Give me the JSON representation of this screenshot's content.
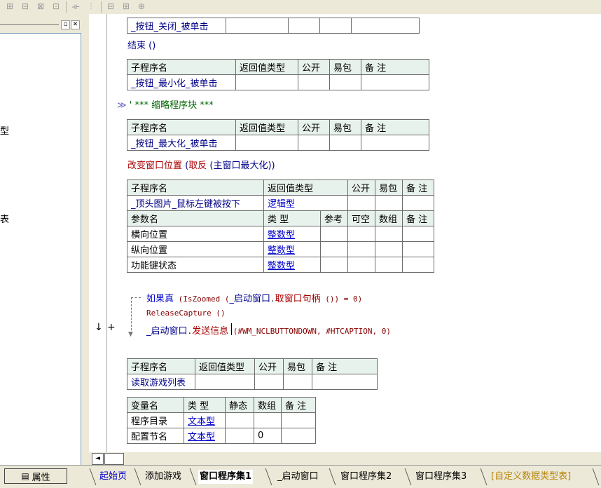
{
  "toolbar": {
    "icons": [
      "align-left-icon",
      "align-center-icon",
      "align-right-icon",
      "align-justify-icon",
      "distribute-h-icon",
      "distribute-v-icon",
      "equal-width-icon",
      "equal-height-icon",
      "equal-size-icon"
    ],
    "glyphs": [
      "⊞",
      "⊟",
      "⊠",
      "⊡",
      "⟛",
      "⫶",
      "⊟",
      "⊞",
      "⊕"
    ]
  },
  "left_panel": {
    "min_glyph": "▫",
    "close_glyph": "✕",
    "glyphs": [
      {
        "text": "型"
      },
      {
        "text": "表"
      }
    ],
    "properties_label": "属性"
  },
  "editor": {
    "table1": {
      "row": [
        "_按钮_关闭_被单击",
        "",
        "",
        "",
        ""
      ]
    },
    "end_text": "结束 ()",
    "table2": {
      "headers": [
        "子程序名",
        "返回值类型",
        "公开",
        "易包",
        "备 注"
      ],
      "row": [
        "_按钮_最小化_被单击",
        "",
        "",
        "",
        ""
      ]
    },
    "collapsed_marker": "≫",
    "collapsed_text": "' *** 缩略程序块 ***",
    "table3": {
      "headers": [
        "子程序名",
        "返回值类型",
        "公开",
        "易包",
        "备 注"
      ],
      "row": [
        "_按钮_最大化_被单击",
        "",
        "",
        "",
        ""
      ]
    },
    "code1": {
      "cmd": "改变窗口位置",
      "open": " (",
      "fn": "取反",
      "open2": " (",
      "arg": "主窗口最大化",
      "close": "))"
    },
    "table4": {
      "headers": [
        "子程序名",
        "返回值类型",
        "公开",
        "易包",
        "备 注"
      ],
      "row": [
        "_顶头图片_鼠标左键被按下",
        "逻辑型",
        "",
        "",
        ""
      ],
      "param_headers": [
        "参数名",
        "类 型",
        "参考",
        "可空",
        "数组",
        "备 注"
      ],
      "params": [
        [
          "横向位置",
          "整数型",
          "",
          "",
          "",
          ""
        ],
        [
          "纵向位置",
          "整数型",
          "",
          "",
          "",
          ""
        ],
        [
          "功能键状态",
          "整数型",
          "",
          "",
          "",
          ""
        ]
      ]
    },
    "code2": {
      "kw": "如果真",
      "a": " (IsZoomed (",
      "b": "_启动窗口",
      "c": ".",
      "d": "取窗口句柄",
      "e": " ()) = 0)"
    },
    "code3": {
      "text": "ReleaseCapture ()"
    },
    "code4": {
      "a": "_启动窗口",
      "b": ".",
      "c": "发送信息",
      "d": " (#WM_NCLBUTTONDOWN, #HTCAPTION, 0)"
    },
    "gutter_marks": {
      "arrow": "↓",
      "plus": "+"
    },
    "table5": {
      "headers": [
        "子程序名",
        "返回值类型",
        "公开",
        "易包",
        "备 注"
      ],
      "row": [
        "读取游戏列表",
        "",
        "",
        "",
        ""
      ]
    },
    "table6": {
      "headers": [
        "变量名",
        "类 型",
        "静态",
        "数组",
        "备 注"
      ],
      "rows": [
        [
          "程序目录",
          "文本型",
          "",
          "",
          ""
        ],
        [
          "配置节名",
          "文本型",
          "",
          "0",
          ""
        ]
      ]
    }
  },
  "hscroll": {
    "left_arrow": "◄"
  },
  "tabs": [
    {
      "label": "起始页",
      "active": false
    },
    {
      "label": "添加游戏",
      "active": false
    },
    {
      "label": "窗口程序集1",
      "active": true
    },
    {
      "label": "_启动窗口",
      "active": false
    },
    {
      "label": "窗口程序集2",
      "active": false
    },
    {
      "label": "窗口程序集3",
      "active": false
    },
    {
      "label": "[自定义数据类型表]",
      "active": false
    }
  ],
  "colors": {
    "header_bg": "#e8f2ec",
    "keyword_blue": "#0000cc",
    "command_red": "#aa0000",
    "comment_green": "#006600",
    "type_yellow": "#b8860b"
  }
}
